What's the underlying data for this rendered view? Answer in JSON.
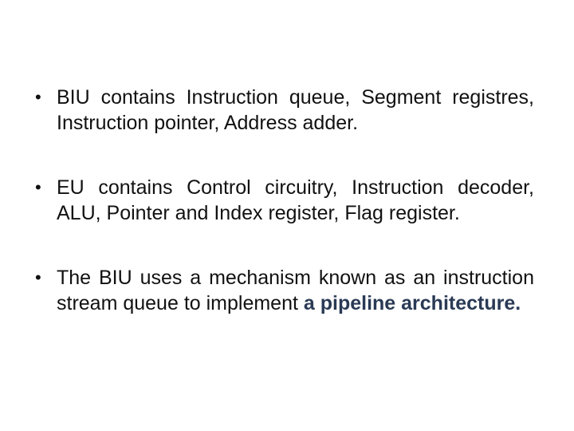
{
  "slide": {
    "bullets": [
      {
        "text": "BIU contains Instruction queue, Segment registres, Instruction pointer, Address adder.",
        "emphasis": ""
      },
      {
        "text": "EU contains Control circuitry, Instruction decoder, ALU, Pointer and Index register, Flag register.",
        "emphasis": ""
      },
      {
        "text": "The BIU uses a mechanism known as an instruction stream queue to implement ",
        "emphasis": "a pipeline architecture."
      }
    ],
    "bullet_glyph": "•",
    "colors": {
      "text": "#111111",
      "emphasis": "#2a3a55",
      "background": "#ffffff"
    }
  }
}
